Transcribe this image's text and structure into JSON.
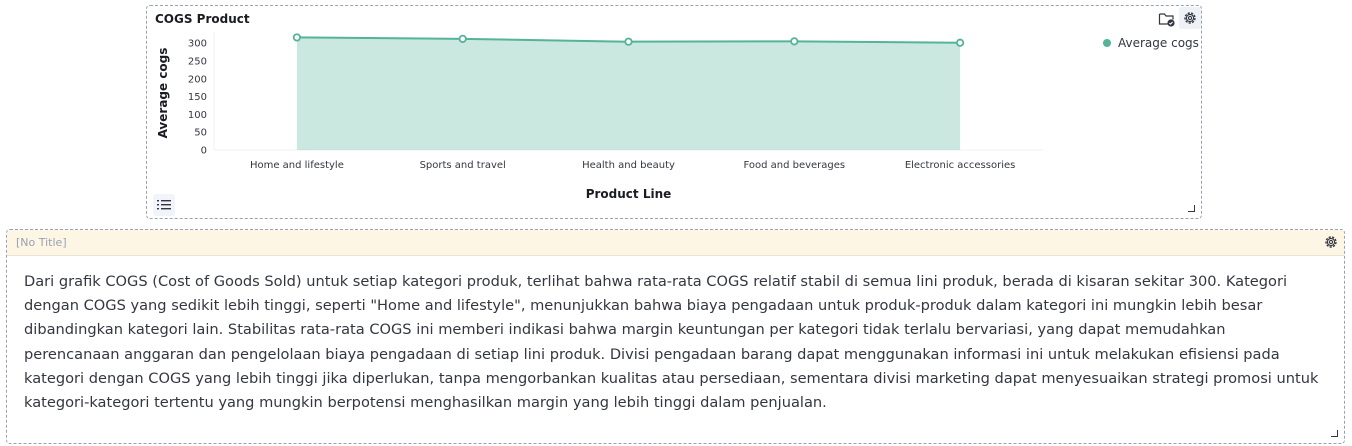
{
  "chart_panel": {
    "title": "COGS Product",
    "icons": {
      "action": "folder-check-icon",
      "settings": "gear-icon",
      "legend_toggle": "list-icon"
    }
  },
  "chart_data": {
    "type": "area",
    "categories": [
      "Home and lifestyle",
      "Sports and travel",
      "Health and beauty",
      "Food and beverages",
      "Electronic accessories"
    ],
    "series": [
      {
        "name": "Average cogs",
        "values": [
          316,
          312,
          304,
          305,
          301
        ],
        "color": "#54b399"
      }
    ],
    "xlabel": "Product Line",
    "ylabel": "Average cogs",
    "yticks": [
      0,
      50,
      100,
      150,
      200,
      250,
      300
    ],
    "ylim": [
      0,
      320
    ],
    "grid": false,
    "legend_position": "right"
  },
  "text_panel": {
    "title": "[No Title]",
    "settings_icon": "gear-icon",
    "body": "Dari grafik COGS (Cost of Goods Sold) untuk setiap kategori produk, terlihat bahwa rata-rata COGS relatif stabil di semua lini produk, berada di kisaran sekitar 300. Kategori dengan COGS yang sedikit lebih tinggi, seperti \"Home and lifestyle\", menunjukkan bahwa biaya pengadaan untuk produk-produk dalam kategori ini mungkin lebih besar dibandingkan kategori lain. Stabilitas rata-rata COGS ini memberi indikasi bahwa margin keuntungan per kategori tidak terlalu bervariasi, yang dapat memudahkan perencanaan anggaran dan pengelolaan biaya pengadaan di setiap lini produk. Divisi pengadaan barang dapat menggunakan informasi ini untuk melakukan efisiensi pada kategori dengan COGS yang lebih tinggi jika diperlukan, tanpa mengorbankan kualitas atau persediaan, sementara divisi marketing dapat menyesuaikan strategi promosi untuk kategori-kategori tertentu yang mungkin berpotensi menghasilkan margin yang lebih tinggi dalam penjualan."
  }
}
